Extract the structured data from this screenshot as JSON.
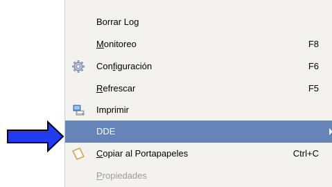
{
  "menu": {
    "items": [
      {
        "label": "Borrar Log",
        "mnemonic": "",
        "shortcut": ""
      },
      {
        "label_pre": "",
        "mnemonic": "M",
        "label_post": "onitoreo",
        "shortcut": "F8"
      },
      {
        "label_pre": "Con",
        "mnemonic": "f",
        "label_post": "iguración",
        "shortcut": "F6",
        "icon": "gear-icon"
      },
      {
        "label_pre": "",
        "mnemonic": "R",
        "label_post": "efrescar",
        "shortcut": "F5"
      },
      {
        "label": "Imprimir",
        "icon": "printer-icon",
        "shortcut": ""
      },
      {
        "label": "DDE",
        "submenu": true,
        "highlighted": true
      },
      {
        "label_pre": "",
        "mnemonic": "C",
        "label_post": "opiar al Portapapeles",
        "shortcut": "Ctrl+C",
        "icon": "clipboard-icon"
      },
      {
        "label_pre": "",
        "mnemonic": "P",
        "label_post": "ropiedades",
        "disabled": true
      }
    ]
  },
  "colors": {
    "menu_bg": "#f3f2ee",
    "highlight": "#6585b8",
    "pointer_arrow": "#1f3cf0",
    "disabled_text": "#9a9a96"
  }
}
